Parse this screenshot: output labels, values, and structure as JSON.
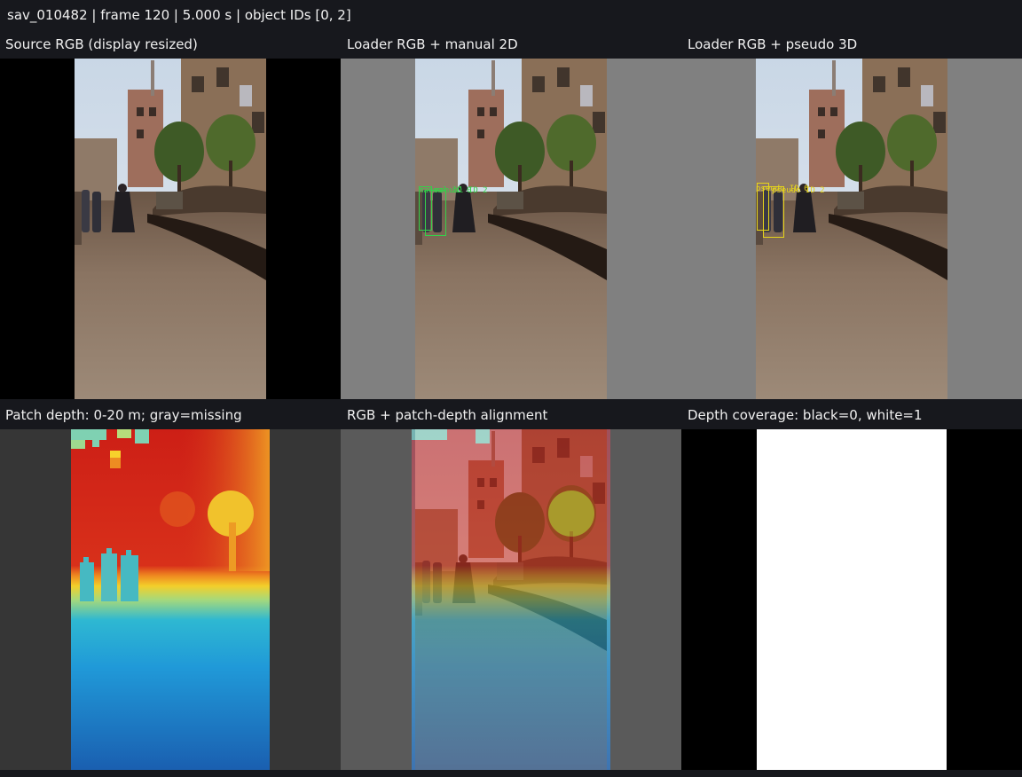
{
  "header": {
    "title": "sav_010482 | frame 120 | 5.000 s | object IDs [0, 2]"
  },
  "panels": [
    {
      "title": "Source RGB (display resized)"
    },
    {
      "title": "Loader RGB + manual 2D",
      "box_labels": [
        "manual ID 0",
        "manual ID 2"
      ]
    },
    {
      "title": "Loader RGB + pseudo 3D",
      "box_labels": [
        "pseudo ID 0",
        "pseudo ID 2"
      ]
    },
    {
      "title": "Patch depth: 0-20 m; gray=missing"
    },
    {
      "title": "RGB + patch-depth alignment"
    },
    {
      "title": "Depth coverage: black=0, white=1"
    }
  ],
  "colors": {
    "manual_box": "#35d04a",
    "pseudo_box": "#e6d51a",
    "panel_gray": "#808080",
    "dark_gray": "#363636",
    "coverage_white": "#ffffff"
  }
}
